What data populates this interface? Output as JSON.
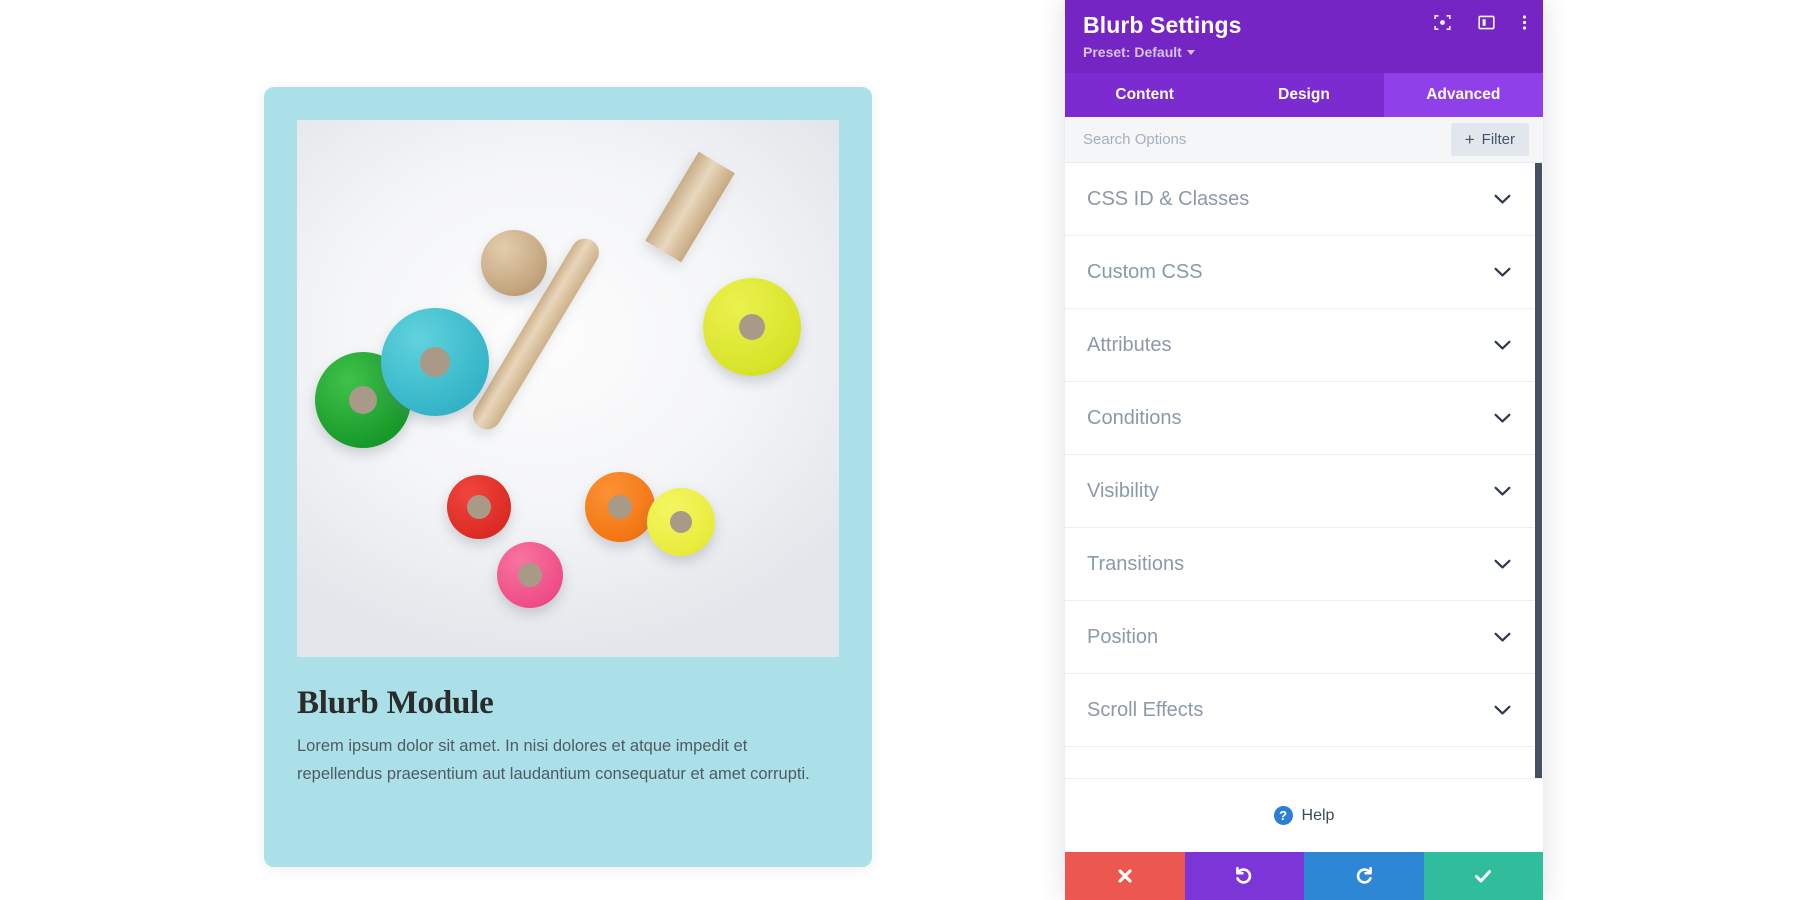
{
  "preview": {
    "card": {
      "background_color": "#ace0e8",
      "image": {
        "alt_name": "wooden-toy-discs-photo",
        "description": "Overhead photo of colorful wooden toy discs, a wooden ball and a wooden toy hammer on a white surface",
        "objects": [
          {
            "name": "green-disc",
            "color": "#199b2b"
          },
          {
            "name": "teal-disc",
            "color": "#35b6c8"
          },
          {
            "name": "wooden-ball",
            "color": "#c6a982"
          },
          {
            "name": "wooden-hammer",
            "color": "#d9c09a"
          },
          {
            "name": "yellow-large-disc",
            "color": "#d8e32a"
          },
          {
            "name": "red-disc",
            "color": "#dc2b25"
          },
          {
            "name": "orange-disc",
            "color": "#f37714"
          },
          {
            "name": "yellow-small-disc",
            "color": "#e9ec3c"
          },
          {
            "name": "pink-disc",
            "color": "#ef4e86"
          }
        ]
      },
      "title": "Blurb Module",
      "body": "Lorem ipsum dolor sit amet. In nisi dolores et atque impedit et repellendus praesentium aut laudantium consequatur et amet corrupti."
    }
  },
  "panel": {
    "header": {
      "title": "Blurb Settings",
      "preset_label": "Preset: Default",
      "accent_color": "#7425c4",
      "icons": [
        {
          "name": "focus-target-icon",
          "label": "Focus"
        },
        {
          "name": "panel-layout-icon",
          "label": "Layout"
        },
        {
          "name": "more-options-icon",
          "label": "More"
        }
      ]
    },
    "tabs": [
      {
        "name": "tab-content",
        "label": "Content",
        "active": false
      },
      {
        "name": "tab-design",
        "label": "Design",
        "active": false
      },
      {
        "name": "tab-advanced",
        "label": "Advanced",
        "active": true
      }
    ],
    "search": {
      "placeholder": "Search Options",
      "value": "",
      "filter_label": "Filter",
      "filter_plus": "+"
    },
    "sections": [
      {
        "name": "css-id-and-classes",
        "label": "CSS ID & Classes",
        "expanded": false
      },
      {
        "name": "custom-css",
        "label": "Custom CSS",
        "expanded": false
      },
      {
        "name": "attributes",
        "label": "Attributes",
        "expanded": false
      },
      {
        "name": "conditions",
        "label": "Conditions",
        "expanded": false
      },
      {
        "name": "visibility",
        "label": "Visibility",
        "expanded": false
      },
      {
        "name": "transitions",
        "label": "Transitions",
        "expanded": false
      },
      {
        "name": "position",
        "label": "Position",
        "expanded": false
      },
      {
        "name": "scroll-effects",
        "label": "Scroll Effects",
        "expanded": false
      }
    ],
    "help": {
      "label": "Help",
      "icon_glyph": "?",
      "icon_color": "#2c7fd4"
    },
    "actions": [
      {
        "name": "cancel-button",
        "glyph": "✖",
        "color": "#ec5850",
        "label": "Cancel"
      },
      {
        "name": "undo-button",
        "glyph": "↺",
        "color": "#7c35d6",
        "label": "Undo"
      },
      {
        "name": "redo-button",
        "glyph": "↻",
        "color": "#2d87d4",
        "label": "Redo"
      },
      {
        "name": "save-button",
        "glyph": "✔",
        "color": "#2fbd9b",
        "label": "Save"
      }
    ]
  }
}
